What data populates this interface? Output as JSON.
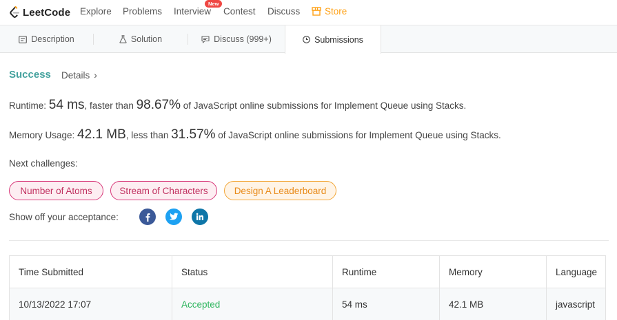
{
  "nav": {
    "logo_text": "LeetCode",
    "links": [
      "Explore",
      "Problems",
      "Interview",
      "Contest",
      "Discuss"
    ],
    "new_badge": "New",
    "store": "Store",
    "store_color": "#ffa116"
  },
  "tabs": [
    {
      "label": "Description",
      "icon": "document-icon"
    },
    {
      "label": "Solution",
      "icon": "flask-icon"
    },
    {
      "label": "Discuss (999+)",
      "icon": "chat-icon"
    },
    {
      "label": "Submissions",
      "icon": "clock-icon",
      "active": true
    }
  ],
  "result": {
    "status": "Success",
    "status_color": "#45a29e",
    "details": "Details",
    "runtime_label": "Runtime: ",
    "runtime_value": "54 ms",
    "runtime_mid": ", faster than ",
    "runtime_pct": "98.67%",
    "runtime_tail": " of JavaScript online submissions for Implement Queue using Stacks.",
    "memory_label": "Memory Usage: ",
    "memory_value": "42.1 MB",
    "memory_mid": ", less than ",
    "memory_pct": "31.57%",
    "memory_tail": " of JavaScript online submissions for Implement Queue using Stacks."
  },
  "next": {
    "label": "Next challenges:",
    "challenges": [
      {
        "title": "Number of Atoms",
        "difficulty": "hard"
      },
      {
        "title": "Stream of Characters",
        "difficulty": "hard"
      },
      {
        "title": "Design A Leaderboard",
        "difficulty": "medium"
      }
    ]
  },
  "share": {
    "label": "Show off your acceptance:",
    "networks": [
      {
        "name": "facebook-icon",
        "color": "#3b5998"
      },
      {
        "name": "twitter-icon",
        "color": "#1da1f2"
      },
      {
        "name": "linkedin-icon",
        "color": "#0e76a8"
      }
    ]
  },
  "table": {
    "headers": [
      "Time Submitted",
      "Status",
      "Runtime",
      "Memory",
      "Language"
    ],
    "rows": [
      {
        "time": "10/13/2022 17:07",
        "status": "Accepted",
        "runtime": "54 ms",
        "memory": "42.1 MB",
        "language": "javascript"
      }
    ]
  }
}
